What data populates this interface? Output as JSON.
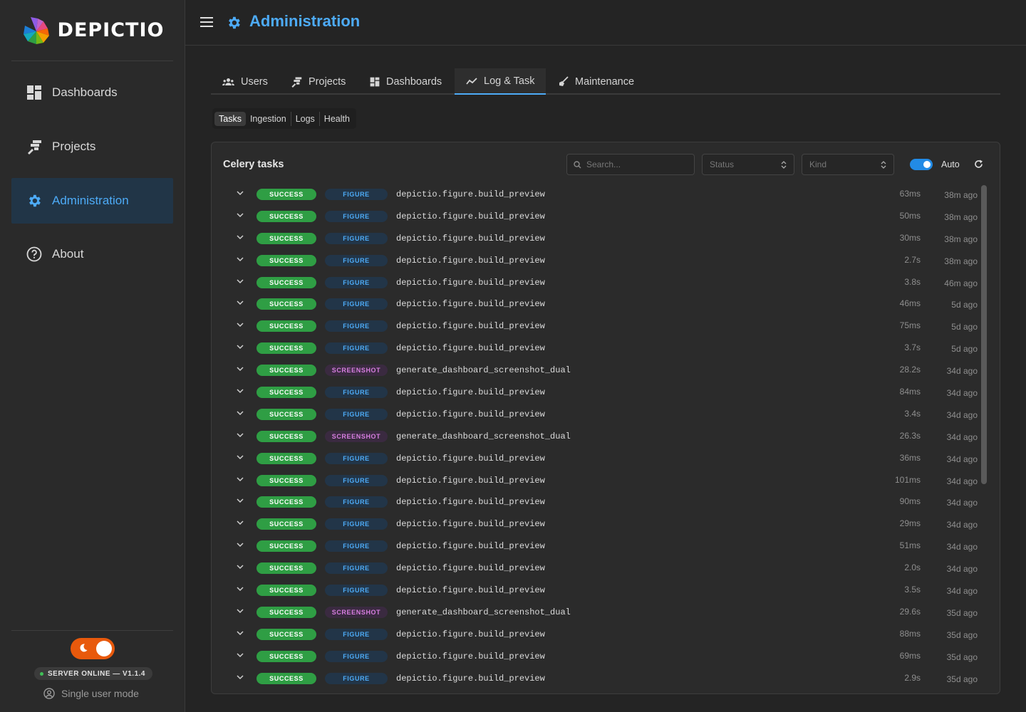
{
  "brand": {
    "name": "DEPICTIO"
  },
  "sidebar": {
    "items": [
      {
        "label": "Dashboards",
        "icon": "dashboard-icon",
        "active": false
      },
      {
        "label": "Projects",
        "icon": "projects-icon",
        "active": false
      },
      {
        "label": "Administration",
        "icon": "gear-icon",
        "active": true
      },
      {
        "label": "About",
        "icon": "help-circle-icon",
        "active": false
      }
    ],
    "server_status": "SERVER ONLINE — V1.1.4",
    "user_mode": "Single user mode"
  },
  "header": {
    "title": "Administration"
  },
  "tabs": [
    {
      "label": "Users",
      "icon": "users-icon"
    },
    {
      "label": "Projects",
      "icon": "projects-icon"
    },
    {
      "label": "Dashboards",
      "icon": "dashboard-icon"
    },
    {
      "label": "Log & Task",
      "icon": "chart-line-icon",
      "active": true
    },
    {
      "label": "Maintenance",
      "icon": "broom-icon"
    }
  ],
  "subtabs": [
    {
      "label": "Tasks",
      "active": true
    },
    {
      "label": "Ingestion"
    },
    {
      "label": "Logs"
    },
    {
      "label": "Health"
    }
  ],
  "panel": {
    "title": "Celery tasks",
    "search_placeholder": "Search...",
    "status_placeholder": "Status",
    "kind_placeholder": "Kind",
    "auto_label": "Auto",
    "auto_enabled": true
  },
  "colors": {
    "accent": "#4dabf7",
    "success": "#2f9e44",
    "screenshot": "#d77ee0",
    "theme_toggle": "#e8590c"
  },
  "tasks": [
    {
      "status": "SUCCESS",
      "kind": "FIGURE",
      "name": "depictio.figure.build_preview",
      "duration": "63ms",
      "ago": "38m ago"
    },
    {
      "status": "SUCCESS",
      "kind": "FIGURE",
      "name": "depictio.figure.build_preview",
      "duration": "50ms",
      "ago": "38m ago"
    },
    {
      "status": "SUCCESS",
      "kind": "FIGURE",
      "name": "depictio.figure.build_preview",
      "duration": "30ms",
      "ago": "38m ago"
    },
    {
      "status": "SUCCESS",
      "kind": "FIGURE",
      "name": "depictio.figure.build_preview",
      "duration": "2.7s",
      "ago": "38m ago"
    },
    {
      "status": "SUCCESS",
      "kind": "FIGURE",
      "name": "depictio.figure.build_preview",
      "duration": "3.8s",
      "ago": "46m ago"
    },
    {
      "status": "SUCCESS",
      "kind": "FIGURE",
      "name": "depictio.figure.build_preview",
      "duration": "46ms",
      "ago": "5d ago"
    },
    {
      "status": "SUCCESS",
      "kind": "FIGURE",
      "name": "depictio.figure.build_preview",
      "duration": "75ms",
      "ago": "5d ago"
    },
    {
      "status": "SUCCESS",
      "kind": "FIGURE",
      "name": "depictio.figure.build_preview",
      "duration": "3.7s",
      "ago": "5d ago"
    },
    {
      "status": "SUCCESS",
      "kind": "SCREENSHOT",
      "name": "generate_dashboard_screenshot_dual",
      "duration": "28.2s",
      "ago": "34d ago"
    },
    {
      "status": "SUCCESS",
      "kind": "FIGURE",
      "name": "depictio.figure.build_preview",
      "duration": "84ms",
      "ago": "34d ago"
    },
    {
      "status": "SUCCESS",
      "kind": "FIGURE",
      "name": "depictio.figure.build_preview",
      "duration": "3.4s",
      "ago": "34d ago"
    },
    {
      "status": "SUCCESS",
      "kind": "SCREENSHOT",
      "name": "generate_dashboard_screenshot_dual",
      "duration": "26.3s",
      "ago": "34d ago"
    },
    {
      "status": "SUCCESS",
      "kind": "FIGURE",
      "name": "depictio.figure.build_preview",
      "duration": "36ms",
      "ago": "34d ago"
    },
    {
      "status": "SUCCESS",
      "kind": "FIGURE",
      "name": "depictio.figure.build_preview",
      "duration": "101ms",
      "ago": "34d ago"
    },
    {
      "status": "SUCCESS",
      "kind": "FIGURE",
      "name": "depictio.figure.build_preview",
      "duration": "90ms",
      "ago": "34d ago"
    },
    {
      "status": "SUCCESS",
      "kind": "FIGURE",
      "name": "depictio.figure.build_preview",
      "duration": "29ms",
      "ago": "34d ago"
    },
    {
      "status": "SUCCESS",
      "kind": "FIGURE",
      "name": "depictio.figure.build_preview",
      "duration": "51ms",
      "ago": "34d ago"
    },
    {
      "status": "SUCCESS",
      "kind": "FIGURE",
      "name": "depictio.figure.build_preview",
      "duration": "2.0s",
      "ago": "34d ago"
    },
    {
      "status": "SUCCESS",
      "kind": "FIGURE",
      "name": "depictio.figure.build_preview",
      "duration": "3.5s",
      "ago": "34d ago"
    },
    {
      "status": "SUCCESS",
      "kind": "SCREENSHOT",
      "name": "generate_dashboard_screenshot_dual",
      "duration": "29.6s",
      "ago": "35d ago"
    },
    {
      "status": "SUCCESS",
      "kind": "FIGURE",
      "name": "depictio.figure.build_preview",
      "duration": "88ms",
      "ago": "35d ago"
    },
    {
      "status": "SUCCESS",
      "kind": "FIGURE",
      "name": "depictio.figure.build_preview",
      "duration": "69ms",
      "ago": "35d ago"
    },
    {
      "status": "SUCCESS",
      "kind": "FIGURE",
      "name": "depictio.figure.build_preview",
      "duration": "2.9s",
      "ago": "35d ago"
    }
  ]
}
